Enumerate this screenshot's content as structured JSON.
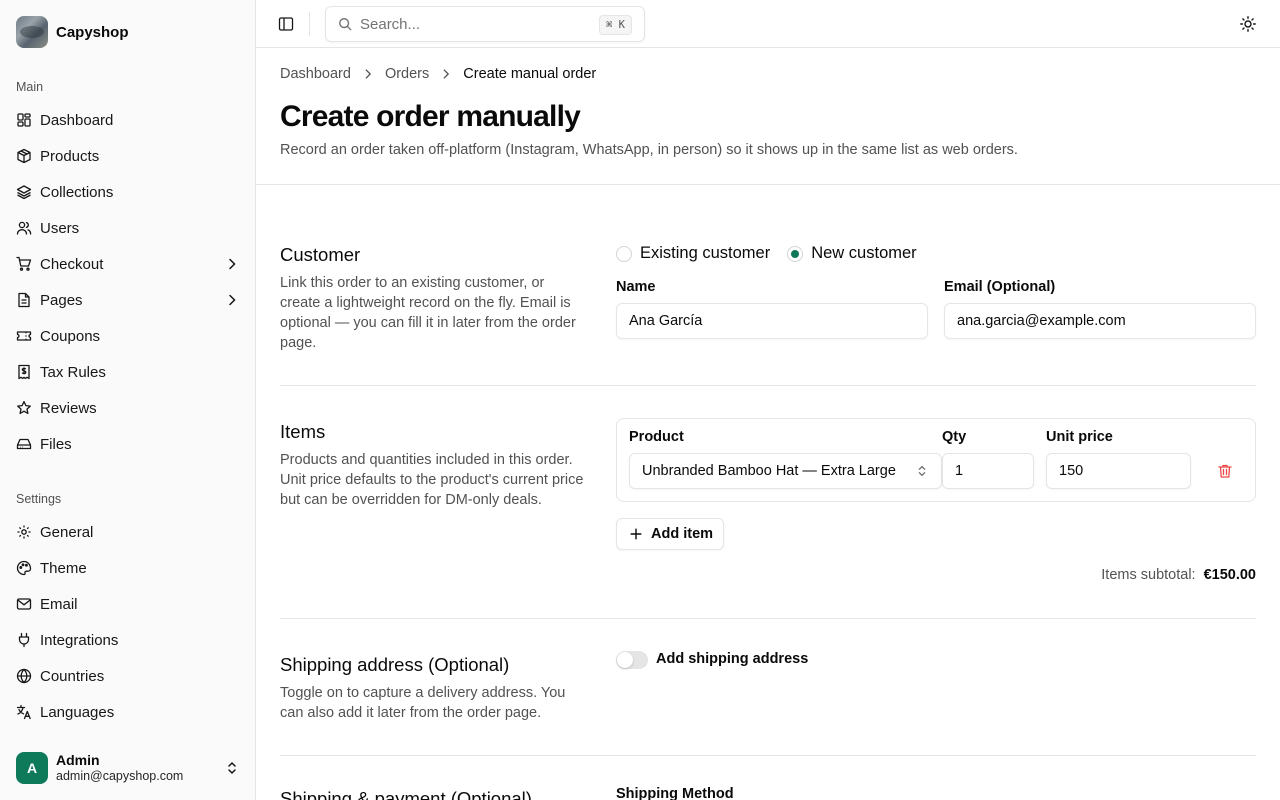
{
  "brand": {
    "name": "Capyshop"
  },
  "sidebar": {
    "main_label": "Main",
    "main_items": [
      {
        "label": "Dashboard",
        "icon": "dashboard-icon"
      },
      {
        "label": "Products",
        "icon": "package-icon"
      },
      {
        "label": "Collections",
        "icon": "layers-icon"
      },
      {
        "label": "Users",
        "icon": "users-icon"
      },
      {
        "label": "Checkout",
        "icon": "cart-icon",
        "expandable": true
      },
      {
        "label": "Pages",
        "icon": "file-icon",
        "expandable": true
      },
      {
        "label": "Coupons",
        "icon": "ticket-icon"
      },
      {
        "label": "Tax Rules",
        "icon": "receipt-icon"
      },
      {
        "label": "Reviews",
        "icon": "star-icon"
      },
      {
        "label": "Files",
        "icon": "hard-drive-icon"
      }
    ],
    "settings_label": "Settings",
    "settings_items": [
      {
        "label": "General",
        "icon": "gear-icon"
      },
      {
        "label": "Theme",
        "icon": "palette-icon"
      },
      {
        "label": "Email",
        "icon": "mail-icon"
      },
      {
        "label": "Integrations",
        "icon": "plug-icon"
      },
      {
        "label": "Countries",
        "icon": "globe-icon"
      },
      {
        "label": "Languages",
        "icon": "languages-icon"
      }
    ],
    "user": {
      "initial": "A",
      "name": "Admin",
      "email": "admin@capyshop.com"
    }
  },
  "topbar": {
    "search_placeholder": "Search...",
    "shortcut": "⌘ K"
  },
  "breadcrumb": [
    "Dashboard",
    "Orders",
    "Create manual order"
  ],
  "page": {
    "title": "Create order manually",
    "subtitle": "Record an order taken off-platform (Instagram, WhatsApp, in person) so it shows up in the same list as web orders."
  },
  "customer": {
    "title": "Customer",
    "description": "Link this order to an existing customer, or create a lightweight record on the fly. Email is optional — you can fill it in later from the order page.",
    "options": [
      "Existing customer",
      "New customer"
    ],
    "selected": "New customer",
    "name_label": "Name",
    "name_value": "Ana García",
    "email_label": "Email (Optional)",
    "email_value": "ana.garcia@example.com"
  },
  "items": {
    "title": "Items",
    "description": "Products and quantities included in this order. Unit price defaults to the product's current price but can be overridden for DM-only deals.",
    "product_label": "Product",
    "qty_label": "Qty",
    "price_label": "Unit price",
    "rows": [
      {
        "product": "Unbranded Bamboo Hat — Extra Large",
        "qty": "1",
        "price": "150"
      }
    ],
    "add_label": "Add item",
    "subtotal_label": "Items subtotal:",
    "subtotal_value": "€150.00"
  },
  "shipping_address": {
    "title": "Shipping address (Optional)",
    "description": "Toggle on to capture a delivery address. You can also add it later from the order page.",
    "toggle_label": "Add shipping address",
    "enabled": false
  },
  "shipping_payment": {
    "title": "Shipping & payment (Optional)",
    "method_label": "Shipping Method"
  },
  "colors": {
    "accent": "#0f7a5a",
    "danger": "#ef4444",
    "border": "#e5e5e5",
    "muted": "#525252"
  }
}
